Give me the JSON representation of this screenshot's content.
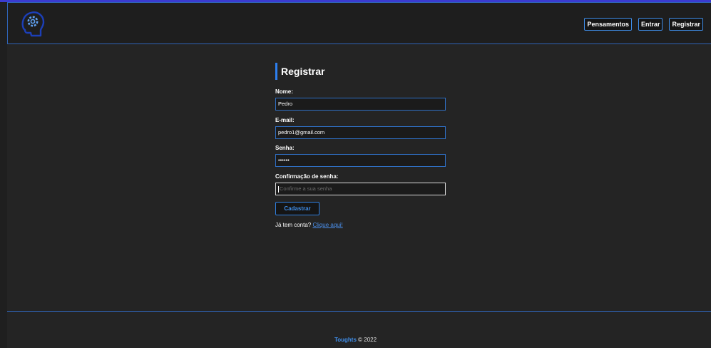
{
  "colors": {
    "accent": "#3f8de8",
    "background": "#242424",
    "navbar": "#1e1e1e"
  },
  "header": {
    "logo_icon": "head-gear-icon",
    "nav": [
      "Pensamentos",
      "Entrar",
      "Registrar"
    ]
  },
  "form": {
    "title": "Registrar",
    "fields": [
      {
        "label": "Nome:",
        "value": "Pedro",
        "placeholder": ""
      },
      {
        "label": "E-mail:",
        "value": "pedro1@gmail.com",
        "placeholder": ""
      },
      {
        "label": "Senha:",
        "value": "••••••",
        "placeholder": ""
      },
      {
        "label": "Confirmação de senha:",
        "value": "",
        "placeholder": "Confirme a sua senha"
      }
    ],
    "submit_label": "Cadastrar",
    "login_prompt": "Já tem conta?",
    "login_link": "Clique aqui!"
  },
  "footer": {
    "brand": "Toughts",
    "copyright": "© 2022"
  }
}
